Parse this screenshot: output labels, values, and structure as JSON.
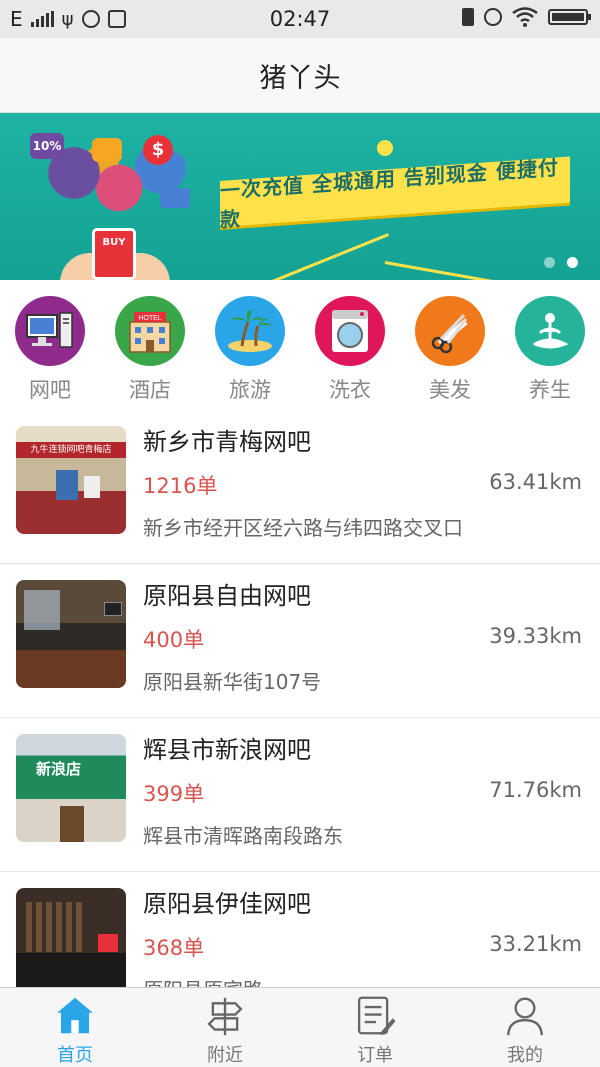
{
  "status_bar": {
    "carrier": "E",
    "time": "02:47"
  },
  "header": {
    "title": "猪丫头"
  },
  "banner": {
    "slogan": "一次充值 全城通用 告别现金 便捷付款",
    "phone_text": "BUY",
    "bubble_text": "10%",
    "page_count": 2,
    "active_page": 2
  },
  "categories": [
    {
      "label": "网吧",
      "icon": "computer-icon",
      "color": "#8e2b8d"
    },
    {
      "label": "酒店",
      "icon": "hotel-icon",
      "color": "#3aa64a",
      "sign": "HOTEL"
    },
    {
      "label": "旅游",
      "icon": "palm-island-icon",
      "color": "#2aa6e8"
    },
    {
      "label": "洗衣",
      "icon": "washing-machine-icon",
      "color": "#e0165a"
    },
    {
      "label": "美发",
      "icon": "scissors-comb-icon",
      "color": "#f07a1a"
    },
    {
      "label": "养生",
      "icon": "meditation-icon",
      "color": "#25b39a"
    }
  ],
  "listings": [
    {
      "name": "新乡市青梅网吧",
      "orders": "1216单",
      "distance": "63.41km",
      "address": "新乡市经开区经六路与纬四路交叉口",
      "sign": "九牛连锁网吧青梅店"
    },
    {
      "name": "原阳县自由网吧",
      "orders": "400单",
      "distance": "39.33km",
      "address": "原阳县新华街107号"
    },
    {
      "name": "辉县市新浪网吧",
      "orders": "399单",
      "distance": "71.76km",
      "address": "辉县市清晖路南段路东",
      "sign": "新浪店"
    },
    {
      "name": "原阳县伊佳网吧",
      "orders": "368单",
      "distance": "33.21km",
      "address": "原阳县原宾路"
    }
  ],
  "tabs": [
    {
      "label": "首页",
      "icon": "home-icon",
      "active": true
    },
    {
      "label": "附近",
      "icon": "signpost-icon",
      "active": false
    },
    {
      "label": "订单",
      "icon": "order-list-icon",
      "active": false
    },
    {
      "label": "我的",
      "icon": "user-icon",
      "active": false
    }
  ],
  "colors": {
    "accent": "#2aa6e8",
    "banner": "#1eb3a4",
    "orders": "#d9534f"
  }
}
